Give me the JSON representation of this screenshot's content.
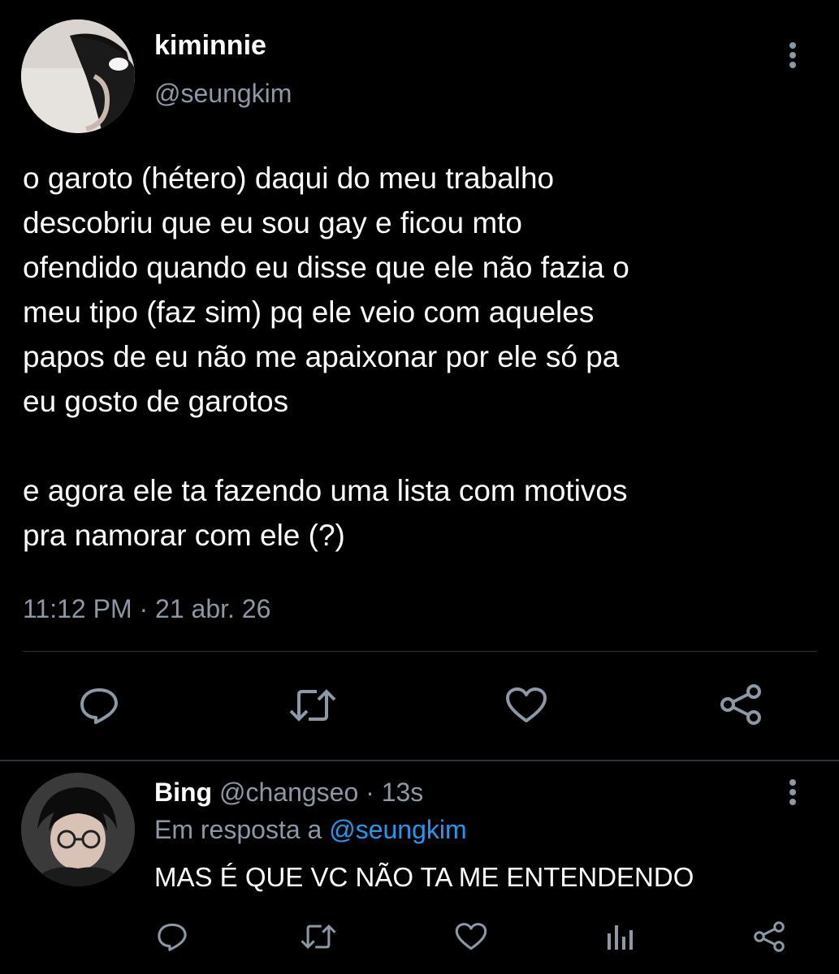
{
  "main_tweet": {
    "display_name": "kiminnie",
    "handle": "@seungkim",
    "text_lines": [
      "o garoto (hétero) daqui do meu trabalho",
      "descobriu que eu sou gay e ficou mto",
      "ofendido quando eu disse que ele não fazia o",
      "meu tipo (faz sim) pq ele veio com aqueles",
      "papos de eu não me apaixonar por ele só pa",
      "eu gosto de garotos",
      "e agora ele ta fazendo uma lista com motivos",
      "pra namorar com ele (?)"
    ],
    "timestamp": "11:12 PM · 21 abr. 26",
    "actions": [
      "reply-icon",
      "retweet-icon",
      "like-icon",
      "share-icon"
    ]
  },
  "reply": {
    "display_name": "Bing",
    "handle": "@changseo",
    "separator": "·",
    "time": "13s",
    "replying_to_prefix": "Em resposta a",
    "replying_to_handle": "@seungkim",
    "text": "MAS É QUE VC NÃO TA ME ENTENDENDO",
    "actions": [
      "reply-icon",
      "retweet-icon",
      "like-icon",
      "analytics-icon",
      "share-icon"
    ]
  },
  "colors": {
    "background": "#000000",
    "text": "#ffffff",
    "secondary": "#8b98a5",
    "accent": "#1d9bf0",
    "divider": "#2f3336"
  }
}
